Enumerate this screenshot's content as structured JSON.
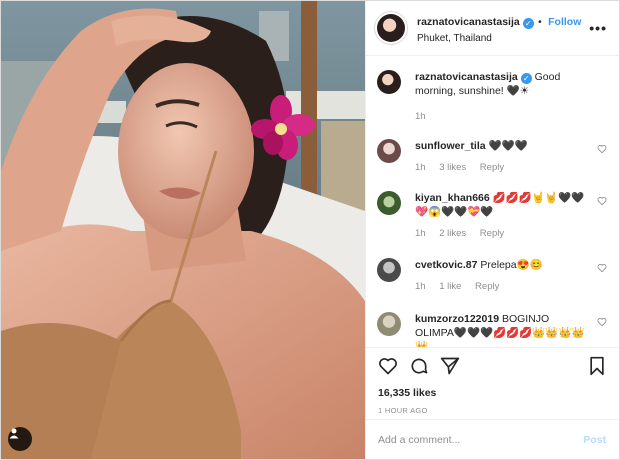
{
  "post": {
    "author": "raznatovicanastasija",
    "follow_label": "Follow",
    "location": "Phuket, Thailand",
    "more_label": "•••",
    "caption": "Good morning, sunshine! 🖤☀",
    "caption_time": "1h"
  },
  "comments": [
    {
      "user": "sunflower_tila",
      "text": "🖤🖤🖤",
      "time": "1h",
      "likes": "3 likes",
      "reply": "Reply"
    },
    {
      "user": "kiyan_khan666",
      "text": "💋💋💋🤘🤘🖤🖤💖😱🖤🖤💝🖤",
      "time": "1h",
      "likes": "2 likes",
      "reply": "Reply"
    },
    {
      "user": "cvetkovic.87",
      "text": "Prelepa😍😊",
      "time": "1h",
      "likes": "1 like",
      "reply": "Reply"
    },
    {
      "user": "kumzorzo122019",
      "text": "BOGINJO OLIMPA🖤🖤🖤💋💋💋👑👑👑👑👑",
      "time": "",
      "likes": "",
      "reply": ""
    }
  ],
  "stats": {
    "likes": "16,335 likes",
    "posted_ago": "1 HOUR AGO"
  },
  "composer": {
    "placeholder": "Add a comment...",
    "post_label": "Post"
  },
  "icons": {
    "like": "heart-icon",
    "comment": "comment-icon",
    "share": "paper-plane-icon",
    "save": "bookmark-icon",
    "tag": "user-tag-icon",
    "verified": "verified-badge-icon"
  }
}
